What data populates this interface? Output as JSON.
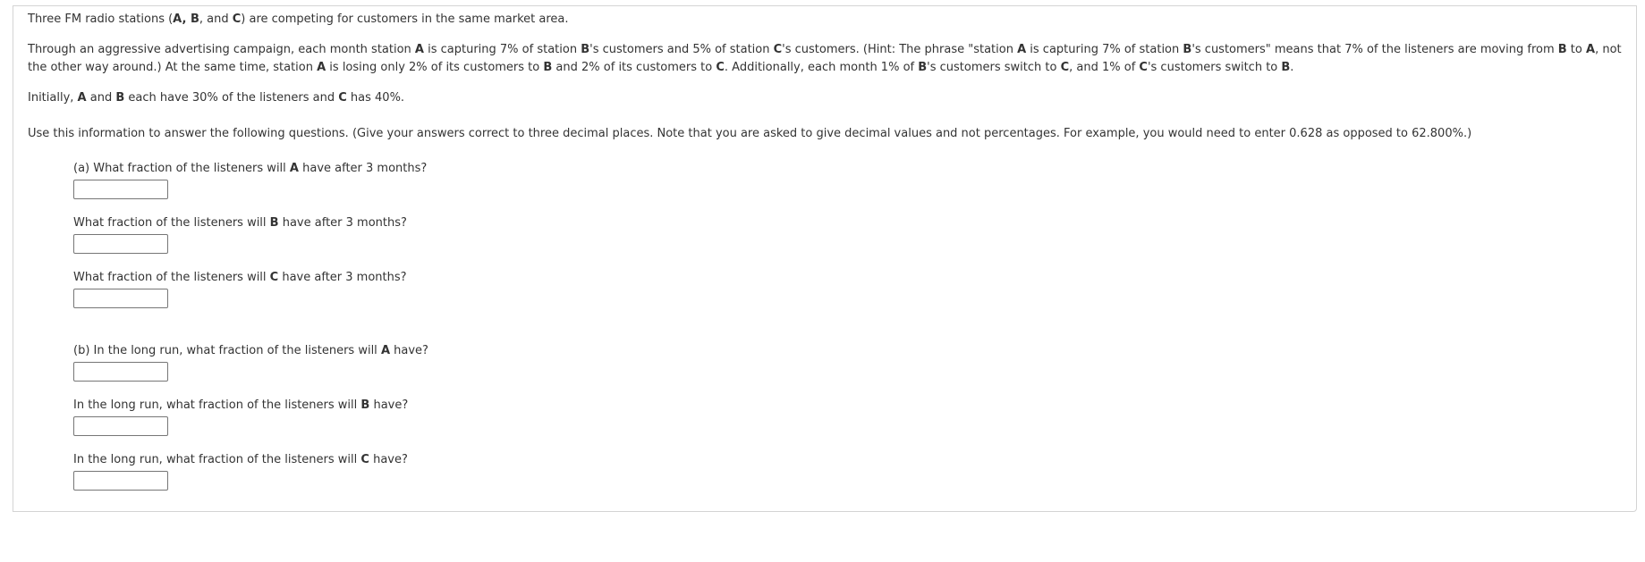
{
  "intro": {
    "p1": [
      "Three FM radio stations (",
      "A",
      ", ",
      "B",
      ", and ",
      "C",
      ") are competing for customers in the same market area."
    ],
    "p2": [
      "Through an aggressive advertising campaign, each month station ",
      "A",
      " is capturing 7% of station ",
      "B",
      "'s customers and 5% of station ",
      "C",
      "'s customers. (Hint: The phrase \"station ",
      "A",
      " is capturing 7% of station ",
      "B",
      "'s customers\" means that 7% of the listeners are moving from ",
      "B",
      " to ",
      "A",
      ", not the other way around.) At the same time, station ",
      "A",
      " is losing only 2% of its customers to ",
      "B",
      " and 2% of its customers to ",
      "C",
      ". Additionally, each month 1% of ",
      "B",
      "'s customers switch to ",
      "C",
      ", and 1% of ",
      "C",
      "'s customers switch to ",
      "B",
      "."
    ],
    "p3": [
      "Initially, ",
      "A",
      " and ",
      "B",
      " each have 30% of the listeners and ",
      "C",
      " has 40%."
    ],
    "p4": "Use this information to answer the following questions. (Give your answers correct to three decimal places. Note that you are asked to give decimal values and not percentages. For example, you would need to enter 0.628 as opposed to 62.800%.)"
  },
  "questions": [
    {
      "pre": "(a) What fraction of the listeners will ",
      "station": "A",
      "post": " have after 3 months?",
      "value": ""
    },
    {
      "pre": "What fraction of the listeners will ",
      "station": "B",
      "post": " have after 3 months?",
      "value": ""
    },
    {
      "pre": "What fraction of the listeners will ",
      "station": "C",
      "post": " have after 3 months?",
      "value": ""
    },
    {
      "pre": "(b) In the long run, what fraction of the listeners will ",
      "station": "A",
      "post": " have?",
      "value": ""
    },
    {
      "pre": "In the long run, what fraction of the listeners will ",
      "station": "B",
      "post": " have?",
      "value": ""
    },
    {
      "pre": "In the long run, what fraction of the listeners will ",
      "station": "C",
      "post": " have?",
      "value": ""
    }
  ]
}
